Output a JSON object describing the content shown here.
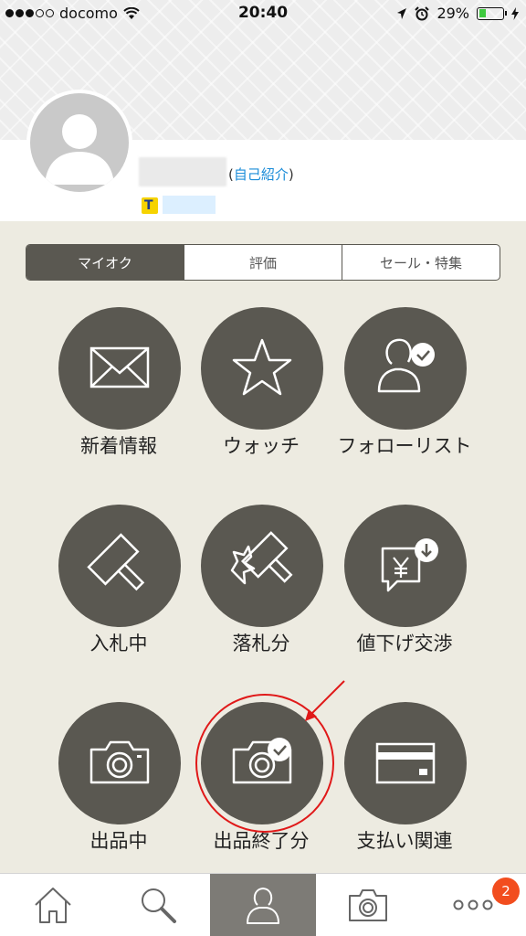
{
  "status_bar": {
    "carrier": "docomo",
    "time": "20:40",
    "battery": "29%",
    "battery_level": 0.29,
    "icons": [
      "signal-dots-icon",
      "wifi-icon",
      "location-icon",
      "alarm-icon",
      "battery-icon",
      "charging-icon"
    ]
  },
  "profile": {
    "self_intro_open": "(",
    "self_intro_link": "自己紹介",
    "self_intro_close": ")",
    "t_badge": "T"
  },
  "tabs": [
    {
      "label": "マイオク",
      "active": true
    },
    {
      "label": "評価",
      "active": false
    },
    {
      "label": "セール・特集",
      "active": false
    }
  ],
  "menu": [
    {
      "label": "新着情報",
      "icon": "envelope-icon"
    },
    {
      "label": "ウォッチ",
      "icon": "star-icon"
    },
    {
      "label": "フォローリスト",
      "icon": "person-check-icon"
    },
    {
      "label": "入札中",
      "icon": "gavel-icon"
    },
    {
      "label": "落札分",
      "icon": "gavel-burst-icon"
    },
    {
      "label": "値下げ交渉",
      "icon": "yen-chat-down-icon"
    },
    {
      "label": "出品中",
      "icon": "camera-icon"
    },
    {
      "label": "出品終了分",
      "icon": "camera-check-icon"
    },
    {
      "label": "支払い関連",
      "icon": "credit-card-icon"
    }
  ],
  "bottom_nav": {
    "items": [
      "home-icon",
      "search-icon",
      "person-icon",
      "camera-icon",
      "more-icon"
    ],
    "active_index": 2,
    "notification_count": "2"
  },
  "colors": {
    "background": "#edebe1",
    "circle": "#5a5851",
    "link": "#1a8cd8",
    "highlight": "#e01919",
    "badge": "#f24d1e"
  }
}
